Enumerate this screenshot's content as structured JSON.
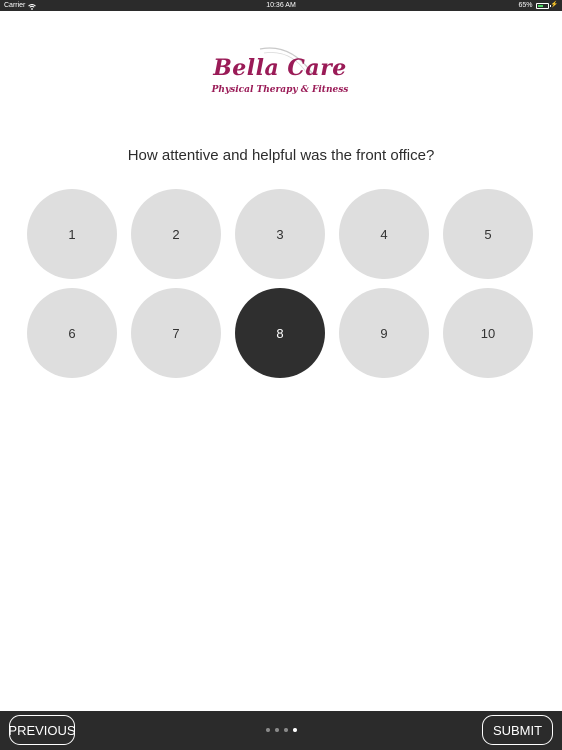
{
  "status_bar": {
    "carrier": "Carrier",
    "time": "10:36 AM",
    "battery": "65%",
    "battery_level": 0.65,
    "icons": [
      "wifi-icon",
      "battery-icon",
      "charging-bolt-icon"
    ]
  },
  "logo": {
    "brand": "Bella Care",
    "tagline": "Physical Therapy & Fitness",
    "color": "#9a1b57"
  },
  "survey": {
    "question": "How attentive and helpful was the front office?",
    "options": [
      "1",
      "2",
      "3",
      "4",
      "5",
      "6",
      "7",
      "8",
      "9",
      "10"
    ],
    "selected": "8"
  },
  "navigation": {
    "previous_label": "PREVIOUS",
    "submit_label": "SUBMIT",
    "page_count": 4,
    "current_page": 4
  },
  "colors": {
    "bar_background": "#2b2b2b",
    "option_default": "#dedede",
    "option_selected": "#2f2f2f"
  }
}
